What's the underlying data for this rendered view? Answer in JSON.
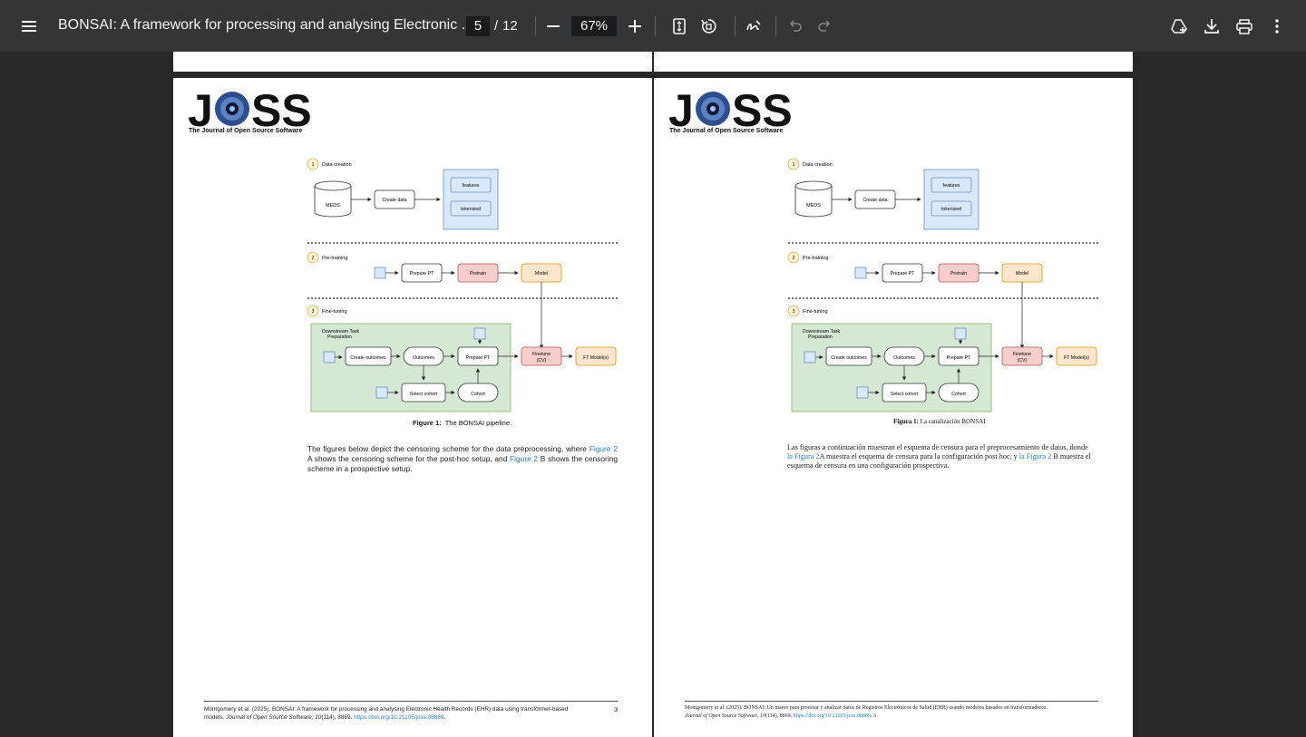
{
  "toolbar": {
    "menu_icon": "hamburger-menu-icon",
    "title": "BONSAI: A framework for processing and analysing Electronic ...",
    "page_current": "5",
    "page_sep": "/",
    "page_total": "12",
    "zoom": "67%",
    "icons": [
      "zoom-out-icon",
      "zoom-in-icon",
      "fit-page-icon",
      "rotate-icon",
      "annotate-icon",
      "undo-icon",
      "redo-icon",
      "save-to-drive-icon",
      "download-icon",
      "print-icon",
      "more-options-icon"
    ]
  },
  "left_page": {
    "logo_text": "JOSS",
    "logo_subtitle": "The Journal of Open Source Software",
    "diagram": {
      "step1": {
        "num": "1",
        "label": "Data creation"
      },
      "step2": {
        "num": "2",
        "label": "Pre-training"
      },
      "step3": {
        "num": "3",
        "label": "Fine-tuning"
      },
      "meds": "MEDS",
      "create_data": "Create data",
      "features": "features",
      "tokenized": "tokenized",
      "prepare_pt": "Prepare PT",
      "pretrain": "Pretrain",
      "model": "Model",
      "downstream": "Downstream Task",
      "preparation": "Preparation",
      "create_outcomes": "Create outcomes",
      "outcomes": "Outcomes",
      "prepare_pt2": "Prepare PT",
      "finetune": "Finetune",
      "cv": "(CV)",
      "ft_models": "FT Model(s)",
      "select_cohort": "Select cohort",
      "cohort": "Cohort"
    },
    "caption_label": "Figure 1:",
    "caption_text": "The BONSAI pipeline.",
    "para": {
      "t1": "The figures below depict the censoring scheme for the data preprocessing, where ",
      "l1": "Figure 2",
      "t2": " A shows the censoring scheme for the post-hoc setup, and ",
      "l2": "Figure 2",
      "t3": " B shows the censoring scheme in a prospective setup."
    },
    "footer": {
      "t1": "Montgomery et al. (2025). BONSAI: A framework for processing and analysing Electronic Health Records (EHR) data using transformer-based",
      "t2": "models. ",
      "journal": "Journal of Open Source Software, 10",
      "t3": "(114), 8869. ",
      "doi": "https://doi.org/10.21105/joss.08869",
      "t4": ".",
      "page_num": "3"
    }
  },
  "right_page": {
    "logo_text": "JOSS",
    "logo_subtitle": "The Journal of Open Source Software",
    "caption_label": "Figura 1:",
    "caption_text": "La canalización BONSAI",
    "para": {
      "t1": "Las figuras a continuación muestran el esquema de censura para el preprocesamiento de datos, donde ",
      "l1": "la Figura 2",
      "t2": "A muestra el esquema de censura para la configuración post hoc, y ",
      "l2": "la Figura 2",
      "t3": " B muestra el esquema de censura en una configuración prospectiva."
    },
    "footer": {
      "t1": "Montgomery et al. (2025). BONSAI: Un marco para procesar y analizar datos de Registros Electrónicos de Salud (EHR) usando modelos basados en transformadores.",
      "journal": "Journal of Open Source Software, 10",
      "t3": "(114), 8869. ",
      "doi": "https://doi.org/10.21105/joss.08869",
      "t4": ". 3"
    }
  },
  "colors": {
    "toolbar_bg": "#323639",
    "viewer_bg": "#282828",
    "link": "#1f7fd6",
    "blue_box": "#dae8fc",
    "red_box": "#f8cecc",
    "orange_box": "#ffe6cc",
    "green_box": "#d5e8d4",
    "step_badge": "#fff2cc"
  }
}
